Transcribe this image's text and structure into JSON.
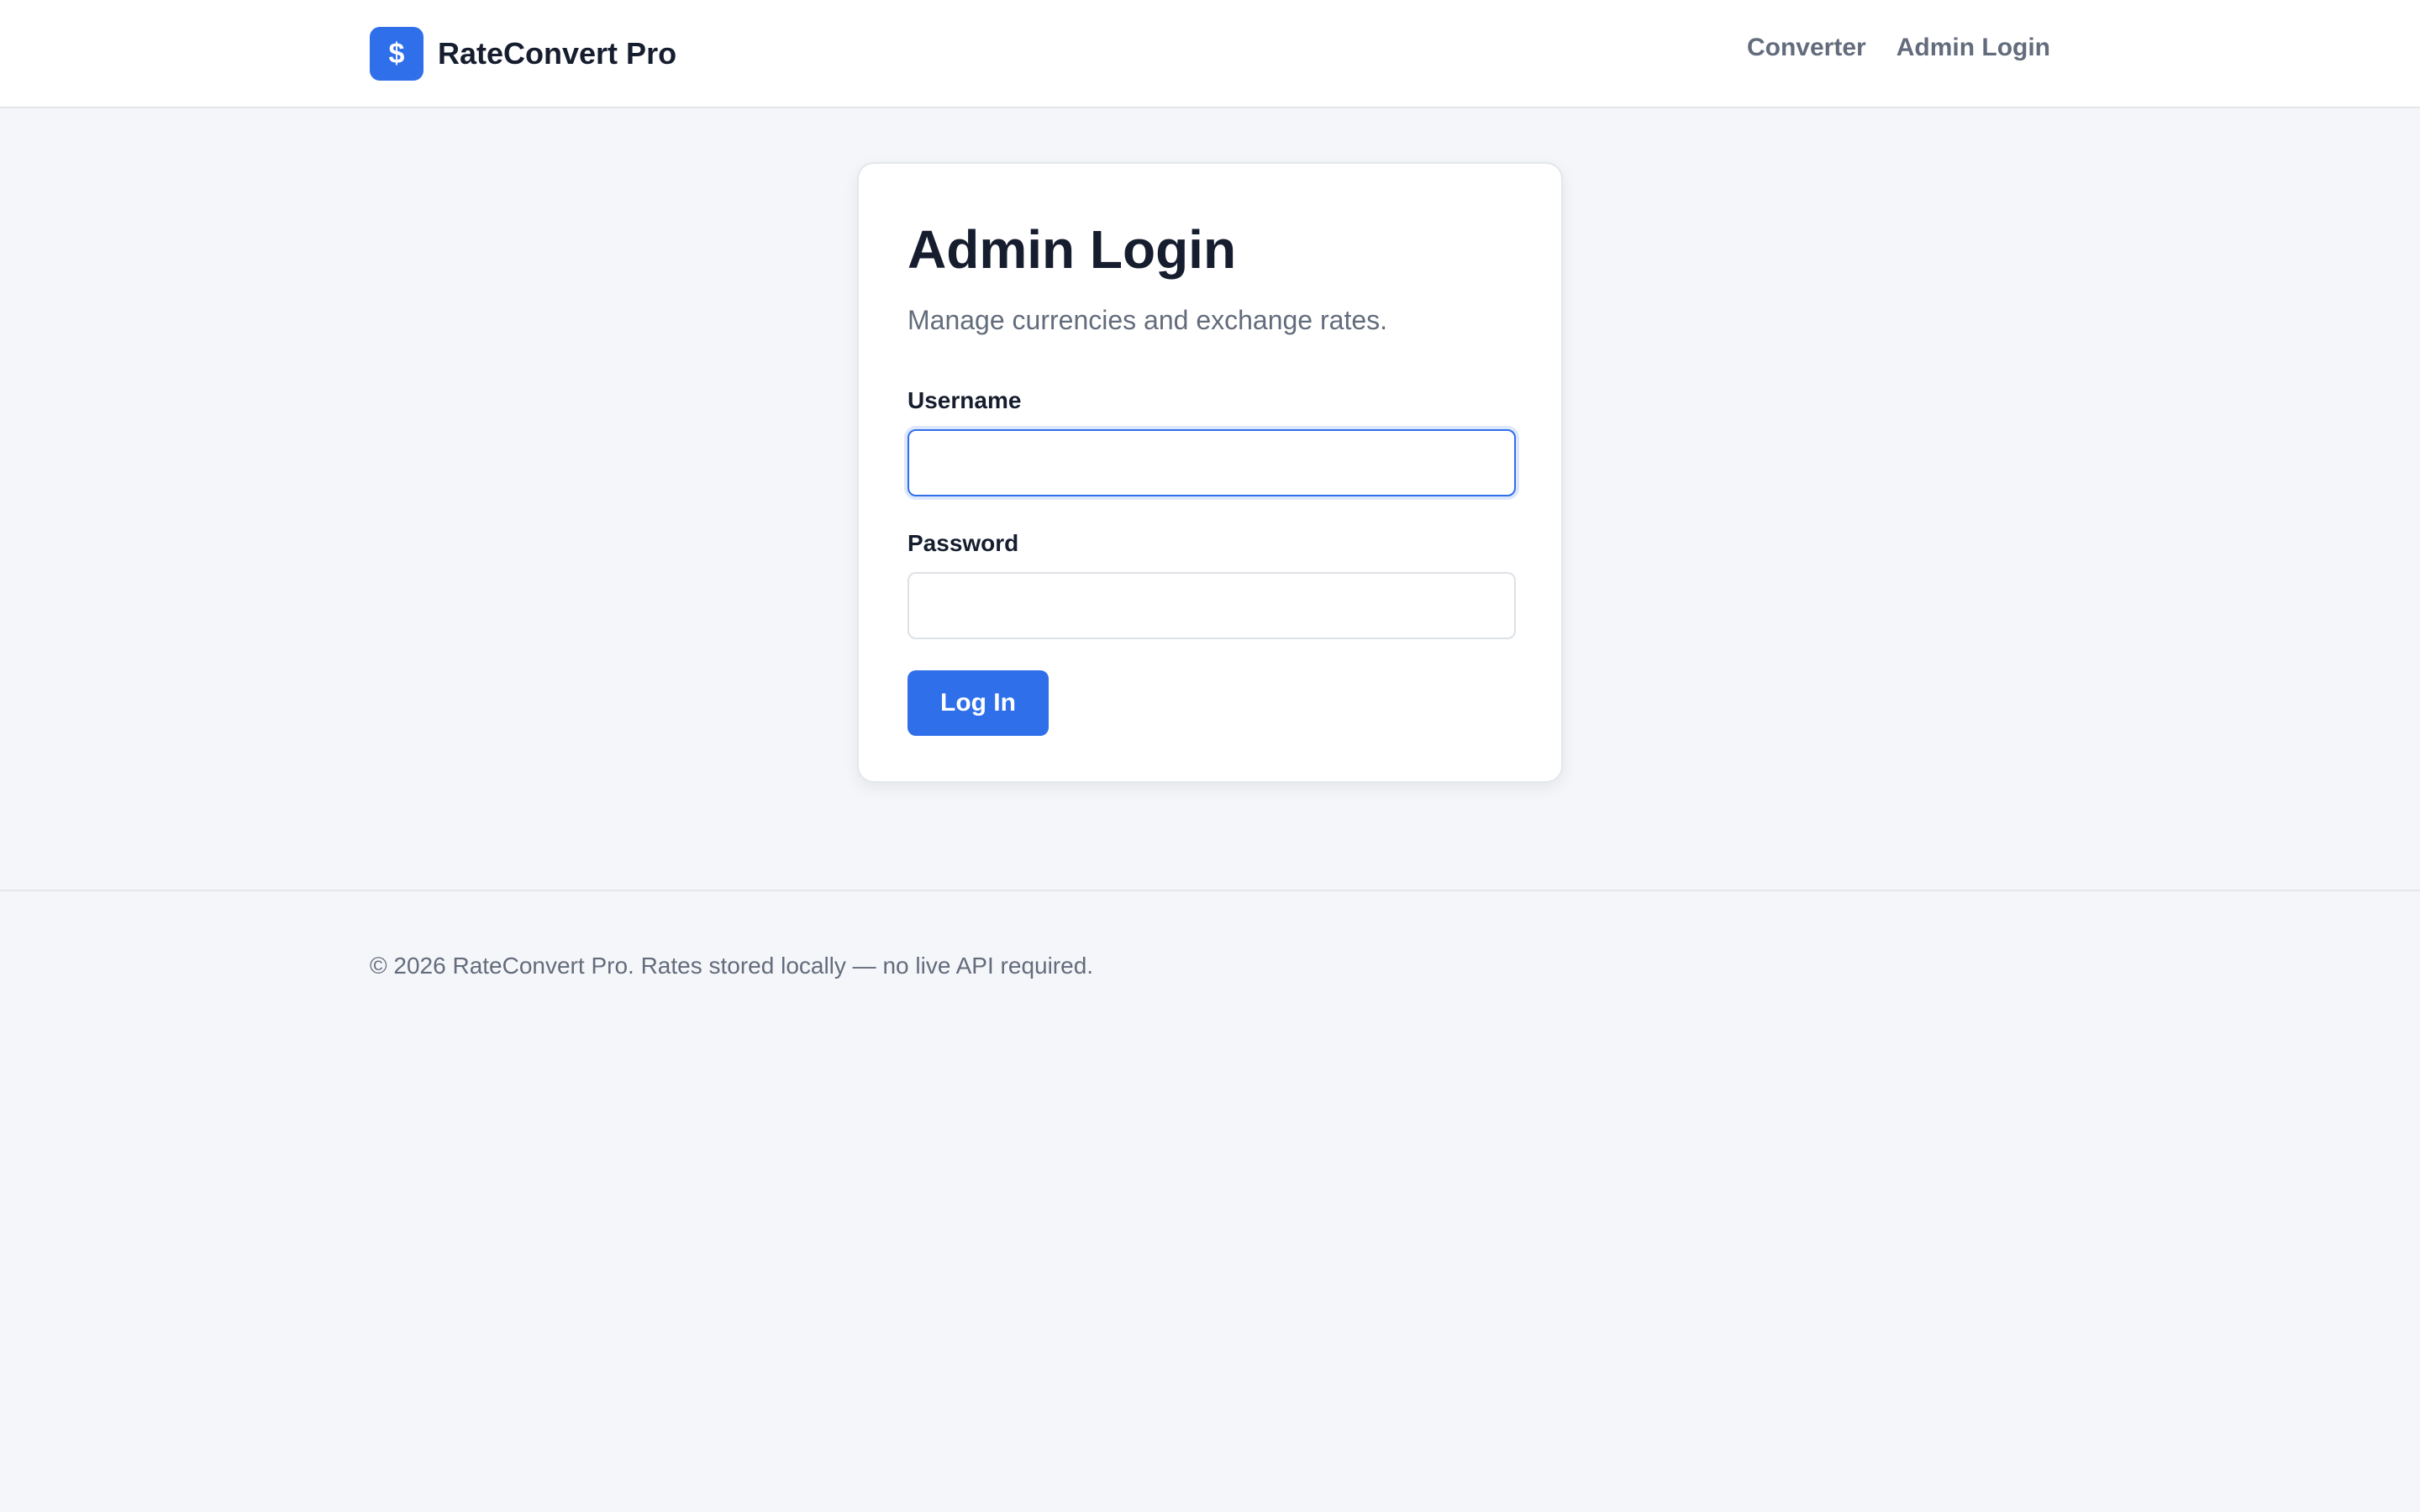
{
  "header": {
    "brand": {
      "logo_symbol": "$",
      "name": "RateConvert Pro",
      "logo_color": "#2f6fea"
    },
    "nav": [
      {
        "label": "Converter"
      },
      {
        "label": "Admin Login"
      }
    ]
  },
  "login_card": {
    "title": "Admin Login",
    "subtitle": "Manage currencies and exchange rates.",
    "username": {
      "label": "Username",
      "value": "",
      "placeholder": ""
    },
    "password": {
      "label": "Password",
      "value": "",
      "placeholder": ""
    },
    "submit_label": "Log In"
  },
  "footer": {
    "text": "© 2026 RateConvert Pro. Rates stored locally — no live API required."
  },
  "colors": {
    "accent": "#2f6fea",
    "text_primary": "#161d2e",
    "text_muted": "#636c7c",
    "page_background": "#f5f6f9"
  }
}
